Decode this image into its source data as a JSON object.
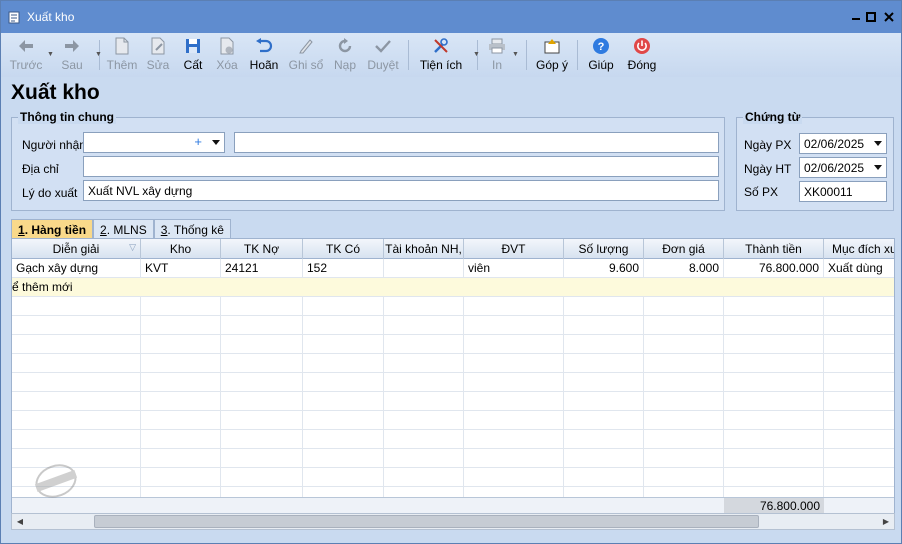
{
  "window": {
    "title": "Xuất kho"
  },
  "toolbar": {
    "buttons": [
      {
        "label": "Trước",
        "icon": "arrow-left-icon"
      },
      {
        "label": "Sau",
        "icon": "arrow-right-icon"
      },
      {
        "label": "Thêm",
        "icon": "add-document-icon"
      },
      {
        "label": "Sửa",
        "icon": "edit-document-icon"
      },
      {
        "label": "Cất",
        "icon": "save-icon"
      },
      {
        "label": "Xóa",
        "icon": "delete-document-icon"
      },
      {
        "label": "Hoãn",
        "icon": "undo-icon"
      },
      {
        "label": "Ghi sổ",
        "icon": "pencil-icon"
      },
      {
        "label": "Nạp",
        "icon": "refresh-icon"
      },
      {
        "label": "Duyệt",
        "icon": "check-icon"
      },
      {
        "label": "Tiện ích",
        "icon": "tools-icon"
      },
      {
        "label": "In",
        "icon": "printer-icon"
      },
      {
        "label": "Góp ý",
        "icon": "feedback-icon"
      },
      {
        "label": "Giúp",
        "icon": "help-icon"
      },
      {
        "label": "Đóng",
        "icon": "power-icon"
      }
    ]
  },
  "page": {
    "heading": "Xuất kho"
  },
  "general": {
    "legend": "Thông tin chung",
    "recipient_label": "Người nhận",
    "recipient_value": "",
    "recipient_name": "",
    "address_label": "Địa chỉ",
    "address_value": "",
    "reason_label": "Lý do xuất",
    "reason_value": "Xuất NVL xây dựng"
  },
  "voucher": {
    "legend": "Chứng từ",
    "posting_date_label": "Ngày PX",
    "posting_date": "02/06/2025",
    "accounting_date_label": "Ngày HT",
    "accounting_date": "02/06/2025",
    "number_label": "Số PX",
    "number": "XK00011"
  },
  "tabs": [
    {
      "key": "1",
      "label": ". Hàng tiền"
    },
    {
      "key": "2",
      "label": ". MLNS"
    },
    {
      "key": "3",
      "label": ". Thống kê"
    }
  ],
  "grid": {
    "columns": [
      "Diễn giải",
      "Kho",
      "TK Nợ",
      "TK Có",
      "Tài khoản NH,",
      "ĐVT",
      "Số lượng",
      "Đơn giá",
      "Thành tiền",
      "Mục đích xuất"
    ],
    "rows": [
      [
        "Gạch xây dựng",
        "KVT",
        "24121",
        "152",
        "",
        "viên",
        "9.600",
        "8.000",
        "76.800.000",
        "Xuất dùng"
      ]
    ],
    "new_row_hint": "ể thêm mới",
    "total": "76.800.000"
  },
  "stamp_text": "CHƯA GHI SỔ",
  "colors": {
    "titlebar": "#5f8ccf",
    "active_tab": "#f9d98a",
    "new_row": "#fdfadc"
  }
}
